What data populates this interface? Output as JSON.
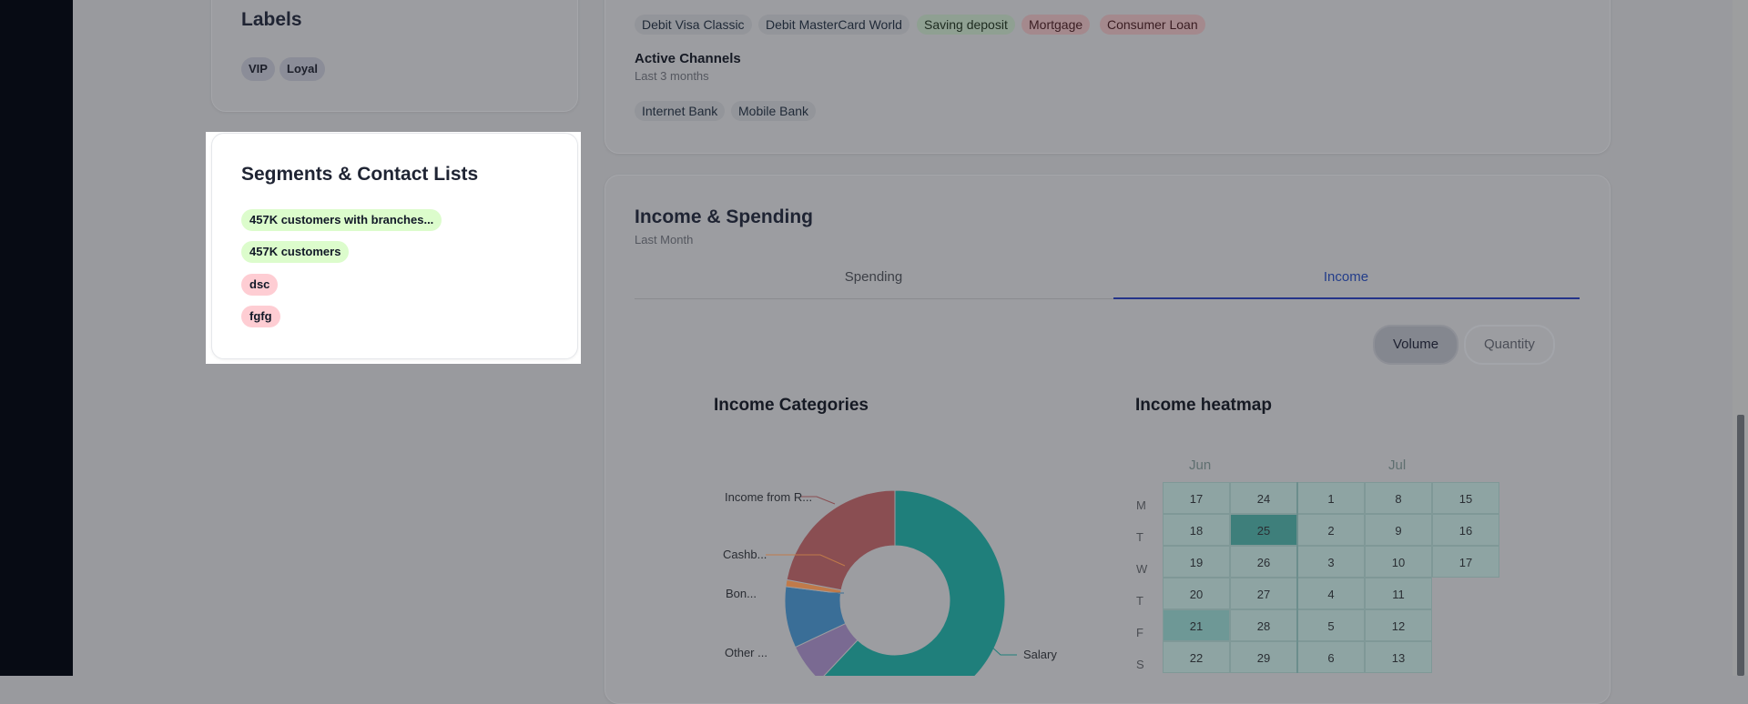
{
  "labels_card": {
    "title": "Labels",
    "pills": [
      {
        "label": "VIP"
      },
      {
        "label": "Loyal"
      }
    ]
  },
  "segments_card": {
    "title": "Segments & Contact Lists",
    "items": [
      {
        "label": "457K customers with branches...",
        "color": "green"
      },
      {
        "label": "457K customers",
        "color": "green"
      },
      {
        "label": "dsc",
        "color": "red"
      },
      {
        "label": "fgfg",
        "color": "red"
      }
    ]
  },
  "products": {
    "tags": [
      {
        "label": "Debit Visa Classic",
        "tone": "neutral"
      },
      {
        "label": "Debit MasterCard World",
        "tone": "neutral"
      },
      {
        "label": "Saving deposit",
        "tone": "green"
      },
      {
        "label": "Mortgage",
        "tone": "red"
      },
      {
        "label": "Consumer Loan",
        "tone": "red"
      }
    ]
  },
  "active_channels": {
    "title": "Active Channels",
    "subtitle": "Last 3 months",
    "tags": [
      {
        "label": "Internet Bank"
      },
      {
        "label": "Mobile Bank"
      }
    ]
  },
  "income_spending": {
    "title": "Income & Spending",
    "subtitle": "Last Month",
    "tabs": [
      {
        "label": "Spending",
        "active": false
      },
      {
        "label": "Income",
        "active": true
      }
    ],
    "toggle": [
      {
        "label": "Volume",
        "active": true
      },
      {
        "label": "Quantity",
        "active": false
      }
    ]
  },
  "income_categories": {
    "title": "Income Categories",
    "labels": {
      "rent": "Income from R...",
      "cashback": "Cashb...",
      "bonus": "Bon...",
      "other": "Other ...",
      "salary": "Salary"
    }
  },
  "income_heatmap": {
    "title": "Income heatmap",
    "months": [
      "Jun",
      "Jul"
    ],
    "day_labels": [
      "M",
      "T",
      "W",
      "T",
      "F",
      "S"
    ],
    "columns": [
      [
        "17",
        "18",
        "19",
        "20",
        "21",
        "22"
      ],
      [
        "24",
        "25",
        "26",
        "27",
        "28",
        "29"
      ],
      [
        "1",
        "2",
        "3",
        "4",
        "5",
        "6"
      ],
      [
        "8",
        "9",
        "10",
        "11",
        "12",
        "13"
      ],
      [
        "15",
        "16",
        "17",
        "",
        "",
        ""
      ]
    ]
  },
  "chart_data": {
    "type": "pie",
    "title": "Income Categories",
    "donut": true,
    "categories": [
      "Salary",
      "Other ...",
      "Bon...",
      "Cashb...",
      "Income from R..."
    ],
    "values": [
      62,
      6,
      9,
      1,
      22
    ],
    "colors": [
      "#1f7f7b",
      "#7a6a92",
      "#3a6e97",
      "#c07a4a",
      "#8a4e52"
    ]
  }
}
